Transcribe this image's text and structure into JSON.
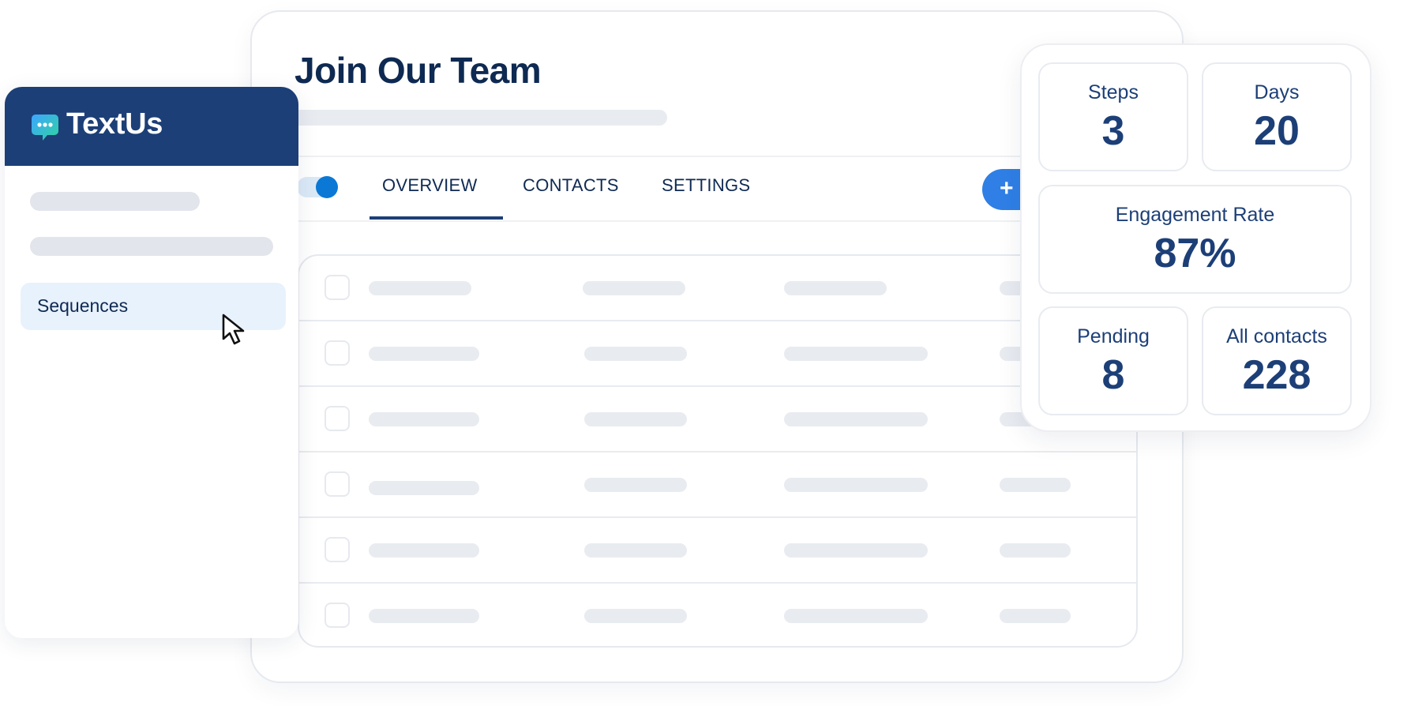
{
  "app": {
    "name": "TextUs"
  },
  "page": {
    "title": "Join Our Team"
  },
  "tabs": [
    {
      "label": "OVERVIEW",
      "active": true
    },
    {
      "label": "CONTACTS",
      "active": false
    },
    {
      "label": "SETTINGS",
      "active": false
    }
  ],
  "toolbar": {
    "add_label": "+"
  },
  "sidebar": {
    "items": [
      {
        "label": "Sequences",
        "active": true
      }
    ]
  },
  "stats": {
    "steps": {
      "label": "Steps",
      "value": "3"
    },
    "days": {
      "label": "Days",
      "value": "20"
    },
    "engagement": {
      "label": "Engagement Rate",
      "value": "87%"
    },
    "pending": {
      "label": "Pending",
      "value": "8"
    },
    "all_contacts": {
      "label": "All contacts",
      "value": "228"
    }
  },
  "colors": {
    "brand_navy": "#1d3f78",
    "accent_blue": "#2f7fe6",
    "skeleton": "#e8ebf0",
    "highlight": "#e8f2fd"
  },
  "icons": {
    "logo": "chat-bubble-icon",
    "cursor": "mouse-pointer-icon"
  }
}
